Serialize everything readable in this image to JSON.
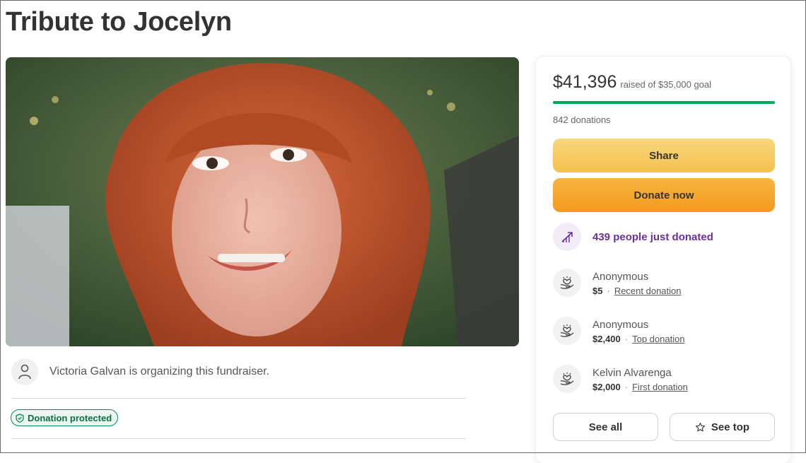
{
  "page": {
    "title": "Tribute to Jocelyn"
  },
  "campaign": {
    "raised_amount": "$41,396",
    "goal_text": "raised of $35,000 goal",
    "progress_fraction": 1.0,
    "donations_count": "842 donations",
    "accent_color": "#02a95c"
  },
  "actions": {
    "share_label": "Share",
    "donate_label": "Donate now"
  },
  "recent": {
    "text": "439 people just donated",
    "icon": "trending-up-icon"
  },
  "donors": [
    {
      "name": "Anonymous",
      "amount": "$5",
      "type": "Recent donation"
    },
    {
      "name": "Anonymous",
      "amount": "$2,400",
      "type": "Top donation"
    },
    {
      "name": "Kelvin Alvarenga",
      "amount": "$2,000",
      "type": "First donation"
    }
  ],
  "buttons": {
    "see_all": "See all",
    "see_top": "See top"
  },
  "organizer": {
    "text": "Victoria Galvan is organizing this fundraiser.",
    "icon": "user-icon"
  },
  "badge": {
    "text": "Donation protected",
    "icon": "shield-check-icon"
  }
}
